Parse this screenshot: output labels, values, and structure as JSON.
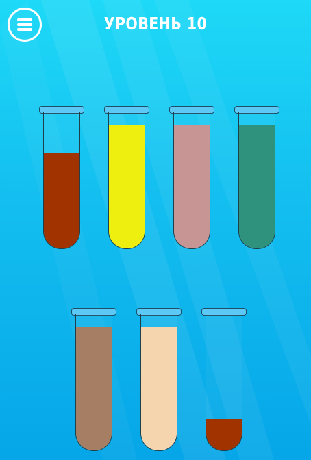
{
  "header": {
    "menu_icon": "menu-icon",
    "level_label": "УРОВЕНЬ 10"
  },
  "tubes": [
    {
      "color": "#a03300",
      "fill": 0.7
    },
    {
      "color": "#eeee0f",
      "fill": 0.91
    },
    {
      "color": "#c69594",
      "fill": 0.91
    },
    {
      "color": "#2f927c",
      "fill": 0.91
    },
    {
      "color": "#a57e64",
      "fill": 0.91
    },
    {
      "color": "#f5d5ae",
      "fill": 0.91
    },
    {
      "color": "#a03300",
      "fill": 0.23
    }
  ]
}
